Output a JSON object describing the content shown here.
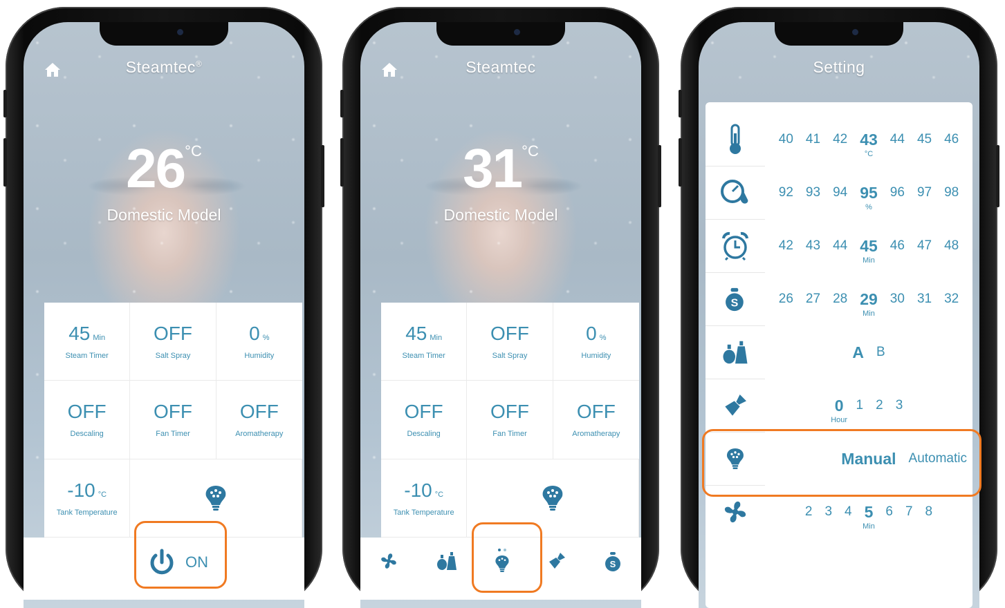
{
  "colors": {
    "accent": "#3c8fb1",
    "highlight": "#f07a22"
  },
  "phone1": {
    "title": "Steamtec",
    "title_reg": "®",
    "temperature": "26",
    "temperature_unit": "°C",
    "model": "Domestic Model",
    "tiles": [
      {
        "value": "45",
        "unit": "Min",
        "label": "Steam Timer"
      },
      {
        "value": "OFF",
        "unit": "",
        "label": "Salt Spray"
      },
      {
        "value": "0",
        "unit": "%",
        "label": "Humidity"
      },
      {
        "value": "OFF",
        "unit": "",
        "label": "Descaling"
      },
      {
        "value": "OFF",
        "unit": "",
        "label": "Fan Timer"
      },
      {
        "value": "OFF",
        "unit": "",
        "label": "Aromatherapy"
      },
      {
        "value": "-10",
        "unit": "°C",
        "label": "Tank Temperature"
      }
    ],
    "power_label": "ON"
  },
  "phone2": {
    "title": "Steamtec",
    "temperature": "31",
    "temperature_unit": "°C",
    "model": "Domestic Model",
    "tiles": [
      {
        "value": "45",
        "unit": "Min",
        "label": "Steam Timer"
      },
      {
        "value": "OFF",
        "unit": "",
        "label": "Salt Spray"
      },
      {
        "value": "0",
        "unit": "%",
        "label": "Humidity"
      },
      {
        "value": "OFF",
        "unit": "",
        "label": "Descaling"
      },
      {
        "value": "OFF",
        "unit": "",
        "label": "Fan Timer"
      },
      {
        "value": "OFF",
        "unit": "",
        "label": "Aromatherapy"
      },
      {
        "value": "-10",
        "unit": "°C",
        "label": "Tank Temperature"
      }
    ],
    "tabs": [
      "fan-icon",
      "aroma-bottles-icon",
      "light-icon",
      "descale-brush-icon",
      "salt-spray-icon"
    ]
  },
  "phone3": {
    "title": "Setting",
    "rows": [
      {
        "icon": "thermometer-icon",
        "left": [
          "40",
          "41",
          "42"
        ],
        "selected": "43",
        "right": [
          "44",
          "45",
          "46"
        ],
        "unit": "°C"
      },
      {
        "icon": "humidity-gauge-icon",
        "left": [
          "92",
          "93",
          "94"
        ],
        "selected": "95",
        "right": [
          "96",
          "97",
          "98"
        ],
        "unit": "%"
      },
      {
        "icon": "alarm-clock-icon",
        "left": [
          "42",
          "43",
          "44"
        ],
        "selected": "45",
        "right": [
          "46",
          "47",
          "48"
        ],
        "unit": "Min"
      },
      {
        "icon": "salt-spray-icon",
        "left": [
          "26",
          "27",
          "28"
        ],
        "selected": "29",
        "right": [
          "30",
          "31",
          "32"
        ],
        "unit": "Min"
      },
      {
        "icon": "aroma-bottles-icon",
        "left": [],
        "selected": "A",
        "right": [
          "B"
        ],
        "unit": ""
      },
      {
        "icon": "descale-brush-icon",
        "left": [],
        "selected": "0",
        "right": [
          "1",
          "2",
          "3"
        ],
        "unit": "Hour"
      },
      {
        "icon": "light-icon",
        "left": [],
        "selected": "Manual",
        "right": [
          "Automatic"
        ],
        "unit": ""
      },
      {
        "icon": "fan-icon",
        "left": [
          "2",
          "3",
          "4"
        ],
        "selected": "5",
        "right": [
          "6",
          "7",
          "8"
        ],
        "unit": "Min"
      }
    ]
  }
}
